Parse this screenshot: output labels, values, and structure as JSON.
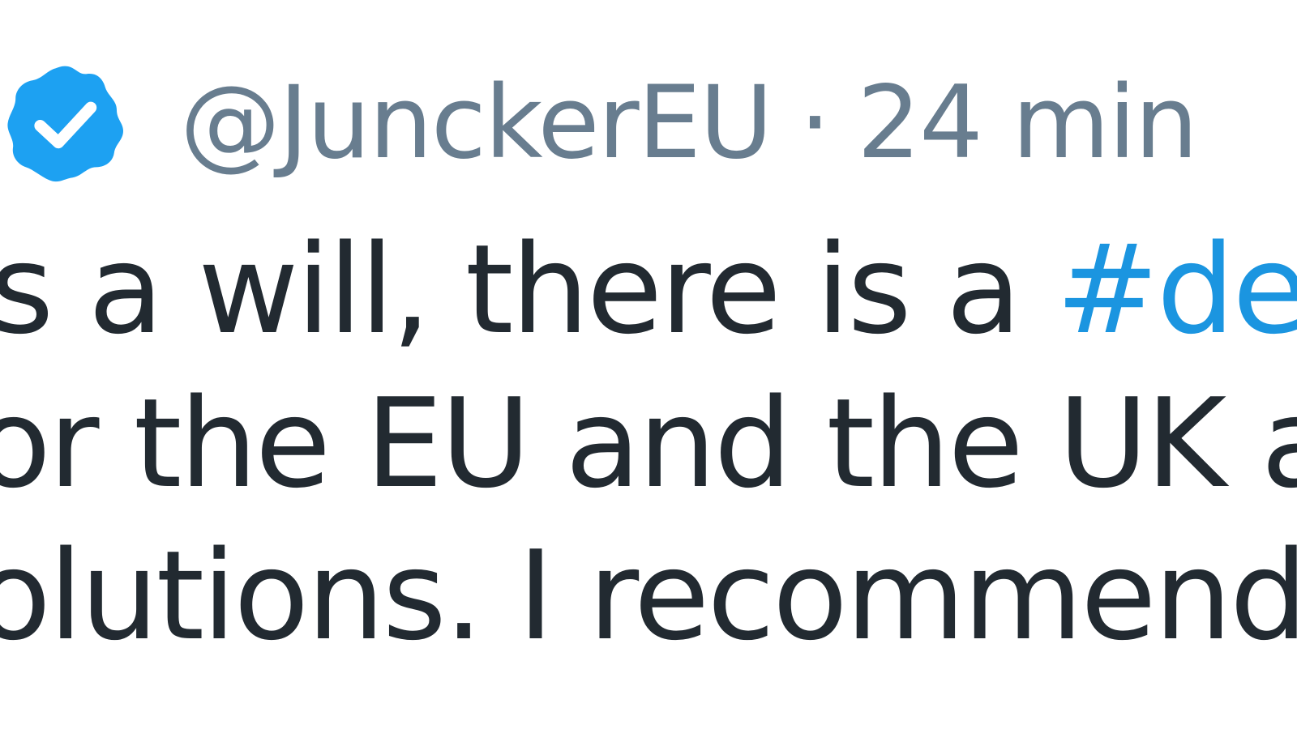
{
  "tweet": {
    "verified_icon": "verified-badge-icon",
    "handle": "@JunckerEU",
    "separator": "·",
    "time": "24 min",
    "lines": {
      "line1_text": "is a will, there is a ",
      "line1_hashtag": "#deal",
      "line2_text": "or the EU and the UK and",
      "line3_text": "olutions. I recommend th"
    }
  },
  "colors": {
    "verified_blue": "#1da1f2",
    "meta_gray": "#687d8f",
    "text_dark": "#222a31",
    "hashtag_blue": "#1b95e0"
  }
}
